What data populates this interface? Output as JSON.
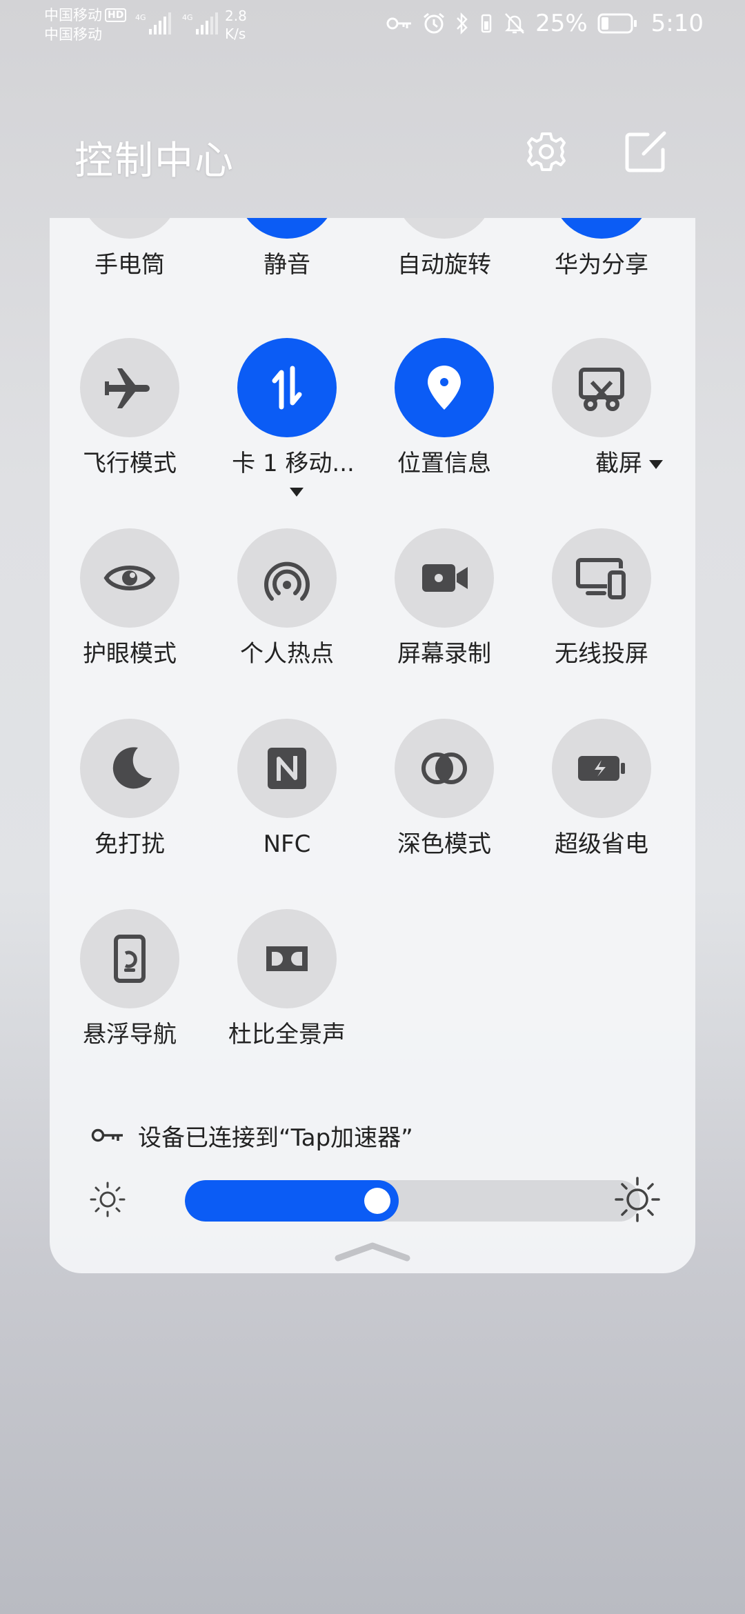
{
  "status_bar": {
    "carrier_1": "中国移动",
    "hd_badge": "HD",
    "carrier_2": "中国移动",
    "signal_1_label": "4G",
    "signal_2_label": "4G",
    "net_speed_value": "2.8",
    "net_speed_unit": "K/s",
    "battery_percent": "25%",
    "battery_level": 0.25,
    "time": "5:10",
    "icons": [
      "key-icon",
      "alarm-icon",
      "bluetooth-icon",
      "vibrate-icon",
      "mute-bell-icon",
      "battery-icon"
    ]
  },
  "header": {
    "title": "控制中心",
    "settings_icon": "gear-icon",
    "edit_icon": "edit-icon"
  },
  "tiles": [
    {
      "key": "flashlight",
      "label": "手电筒",
      "icon": "flashlight-icon",
      "active": false
    },
    {
      "key": "mute",
      "label": "静音",
      "icon": "mute-icon",
      "active": true
    },
    {
      "key": "auto-rotate",
      "label": "自动旋转",
      "icon": "rotate-icon",
      "active": false
    },
    {
      "key": "huawei-share",
      "label": "华为分享",
      "icon": "share-icon",
      "active": true
    },
    {
      "key": "airplane",
      "label": "飞行模式",
      "icon": "airplane-icon",
      "active": false
    },
    {
      "key": "mobile-data",
      "label": "卡 1 移动...",
      "icon": "data-arrows-icon",
      "active": true,
      "dropdown": true
    },
    {
      "key": "location",
      "label": "位置信息",
      "icon": "location-pin-icon",
      "active": true
    },
    {
      "key": "screenshot",
      "label": "截屏",
      "icon": "scissors-screenshot-icon",
      "active": false,
      "dropdown": true
    },
    {
      "key": "eye-comfort",
      "label": "护眼模式",
      "icon": "eye-icon",
      "active": false
    },
    {
      "key": "hotspot",
      "label": "个人热点",
      "icon": "hotspot-icon",
      "active": false
    },
    {
      "key": "screen-record",
      "label": "屏幕录制",
      "icon": "video-camera-icon",
      "active": false
    },
    {
      "key": "wireless-projection",
      "label": "无线投屏",
      "icon": "projection-icon",
      "active": false
    },
    {
      "key": "do-not-disturb",
      "label": "免打扰",
      "icon": "moon-icon",
      "active": false
    },
    {
      "key": "nfc",
      "label": "NFC",
      "icon": "nfc-icon",
      "active": false
    },
    {
      "key": "dark-mode",
      "label": "深色模式",
      "icon": "dark-mode-icon",
      "active": false
    },
    {
      "key": "power-saving",
      "label": "超级省电",
      "icon": "battery-saver-icon",
      "active": false
    },
    {
      "key": "floating-nav",
      "label": "悬浮导航",
      "icon": "floating-nav-icon",
      "active": false
    },
    {
      "key": "dolby",
      "label": "杜比全景声",
      "icon": "dolby-icon",
      "active": false
    }
  ],
  "wifi_status": {
    "icon": "key-icon",
    "text": "设备已连接到“Tap加速器”"
  },
  "brightness": {
    "level": 0.46,
    "low_icon": "sun-small-icon",
    "high_icon": "sun-large-icon"
  },
  "colors": {
    "accent": "#0b5cf5",
    "tile_inactive": "#dcdcde",
    "panel": "#f4f5f7",
    "text": "#222222"
  }
}
